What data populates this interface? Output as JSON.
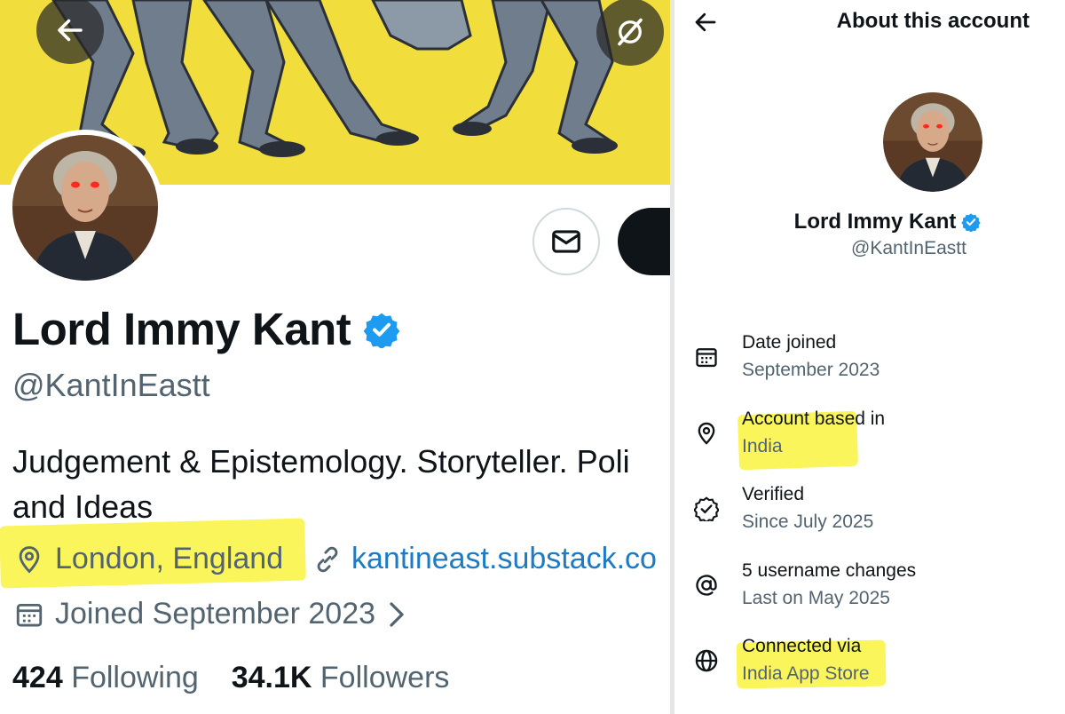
{
  "profile": {
    "name": "Lord Immy Kant",
    "handle": "@KantInEastt",
    "bio_line1": "Judgement & Epistemology. Storyteller. Poli",
    "bio_line2": "and Ideas",
    "location": "London, England",
    "link": "kantineast.substack.co",
    "joined": "Joined September 2023",
    "following_count": "424",
    "following_label": "Following",
    "followers_count": "34.1K",
    "followers_label": "Followers"
  },
  "about": {
    "title": "About this account",
    "name": "Lord Immy Kant",
    "handle": "@KantInEastt",
    "items": [
      {
        "icon": "calendar-icon",
        "label": "Date joined",
        "value": "September 2023"
      },
      {
        "icon": "location-pin-icon",
        "label": "Account based in",
        "value": "India"
      },
      {
        "icon": "verified-badge-icon",
        "label": "Verified",
        "value": "Since July 2025"
      },
      {
        "icon": "at-sign-icon",
        "label": "5 username changes",
        "value": "Last on May 2025"
      },
      {
        "icon": "globe-icon",
        "label": "Connected via",
        "value": "India App Store"
      }
    ]
  },
  "colors": {
    "banner": "#f1de3c",
    "highlight": "#fbf55c",
    "verified": "#1d9bf0",
    "link": "#1d7bc4",
    "secondary_text": "#536471"
  }
}
